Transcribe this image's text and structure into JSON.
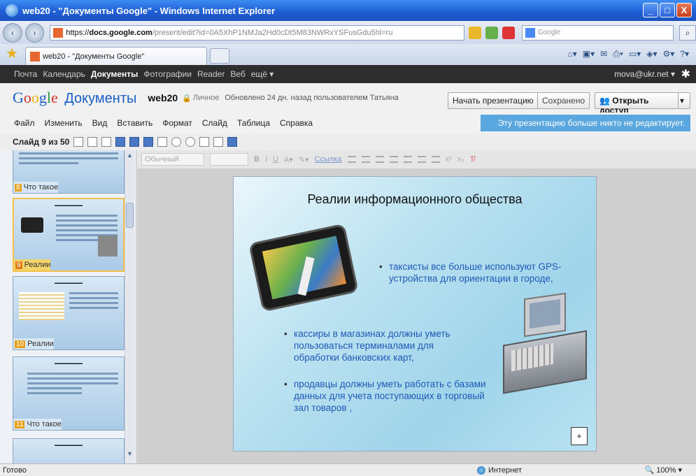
{
  "window": {
    "title": "web20 - \"Документы Google\" - Windows Internet Explorer",
    "buttons": [
      "_",
      "□",
      "X"
    ]
  },
  "address_bar": {
    "url_prefix": "https://",
    "url_domain": "docs.google.com",
    "url_path": "/present/edit?id=0A5XhP1NMJa2Hd0cDt5M83NWRxYSFusGdu5hl=ru",
    "search_engine": "Google"
  },
  "tabs": [
    {
      "label": "web20 - \"Документы Google\"",
      "active": true
    }
  ],
  "google_bar": {
    "items": [
      "Почта",
      "Календарь",
      "Документы",
      "Фотографии",
      "Reader",
      "Веб",
      "ещё ▾"
    ],
    "active_item": "Документы",
    "user": "mova@ukr.net ▾"
  },
  "docs_header": {
    "logo": "Google",
    "product": "Документы",
    "doc_name": "web20",
    "privacy": "Личное",
    "updated": "Обновлено 24 дн. назад пользователем Татьяна",
    "start_presentation": "Начать презентацию",
    "saved": "Сохранено",
    "share": "Открыть доступ"
  },
  "menu": [
    "Файл",
    "Изменить",
    "Вид",
    "Вставить",
    "Формат",
    "Слайд",
    "Таблица",
    "Справка"
  ],
  "banner": "Эту презентацию больше никто не редактирует.",
  "slide_counter": "Слайд 9 из 50",
  "format_bar": {
    "font": "Обычный",
    "link": "Ссылка"
  },
  "filmstrip": [
    {
      "num": "8",
      "label": "Что такое",
      "active": false
    },
    {
      "num": "9",
      "label": "Реалии",
      "active": true
    },
    {
      "num": "10",
      "label": "Реалии",
      "active": false
    },
    {
      "num": "11",
      "label": "Что такое",
      "active": false
    }
  ],
  "slide": {
    "title": "Реалии информационного общества",
    "bullets": [
      "таксисты все больше используют GPS-устройства для ориентации в городе,",
      "кассиры в магазинах должны уметь пользоваться терминалами для обработки банковских карт,",
      "продавцы должны уметь работать с базами данных для учета поступающих в торговый зал товаров ,"
    ]
  },
  "status": {
    "ready": "Готово",
    "zone": "Интернет",
    "zoom": "100%"
  }
}
